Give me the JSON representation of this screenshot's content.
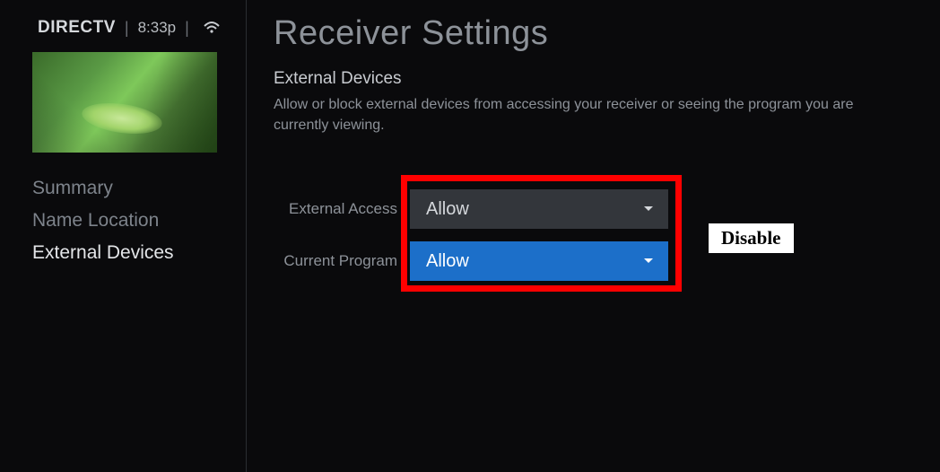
{
  "header": {
    "brand": "DIRECTV",
    "time": "8:33p"
  },
  "sidebar": {
    "items": [
      {
        "label": "Summary",
        "active": false
      },
      {
        "label": "Name Location",
        "active": false
      },
      {
        "label": "External Devices",
        "active": true
      }
    ]
  },
  "main": {
    "title": "Receiver Settings",
    "section_title": "External Devices",
    "section_desc": "Allow or block external devices from accessing your receiver or seeing the program you are currently viewing."
  },
  "settings": {
    "external_access": {
      "label": "External Access",
      "value": "Allow"
    },
    "current_program": {
      "label": "Current Program",
      "value": "Allow"
    }
  },
  "annotation": {
    "callout": "Disable"
  }
}
